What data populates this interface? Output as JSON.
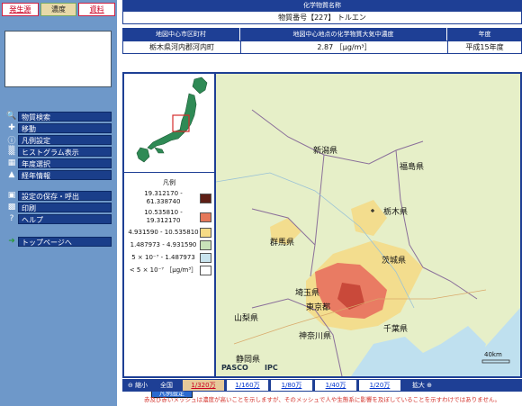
{
  "tabs": [
    {
      "label": "発生源",
      "active": false
    },
    {
      "label": "濃度",
      "active": true
    },
    {
      "label": "資料",
      "active": false
    }
  ],
  "menu1": [
    {
      "icon": "search-icon",
      "label": "物質検索"
    },
    {
      "icon": "move-icon",
      "label": "移動"
    },
    {
      "icon": "info-icon",
      "label": "凡例設定"
    },
    {
      "icon": "histogram-icon",
      "label": "ヒストグラム表示"
    },
    {
      "icon": "calendar-icon",
      "label": "年度選択"
    },
    {
      "icon": "chart-icon",
      "label": "経年情報"
    }
  ],
  "menu2": [
    {
      "icon": "save-icon",
      "label": "設定の保存・呼出"
    },
    {
      "icon": "print-icon",
      "label": "印刷"
    },
    {
      "icon": "help-icon",
      "label": "ヘルプ"
    }
  ],
  "menu3": [
    {
      "icon": "home-arrow-icon",
      "label": "トップページへ"
    }
  ],
  "header": {
    "title": "化学物質名称",
    "substance": "物質番号【227】 トルエン",
    "col1": "地図中心市区町村",
    "col2": "地図中心地点の化学物質大気中濃度",
    "col3": "年度",
    "city": "栃木県河内郡河内町",
    "conc": "2.87 ［µg/m³］",
    "year": "平成15年度"
  },
  "legend": {
    "title": "凡例",
    "items": [
      {
        "label": "19.312170 - 61.338740",
        "color": "#5e1f16"
      },
      {
        "label": "10.535810 - 19.312170",
        "color": "#e5785a"
      },
      {
        "label": "4.931590 - 10.535810",
        "color": "#f6db86"
      },
      {
        "label": "1.487973 - 4.931590",
        "color": "#c9e2b9"
      },
      {
        "label": "5 × 10⁻⁷ - 1.487973",
        "color": "#c9e4ee"
      },
      {
        "label": "< 5 × 10⁻⁷ ［µg/m³］",
        "color": "#ffffff"
      }
    ],
    "button": "凡例設定"
  },
  "map": {
    "labels": {
      "niigata": "新潟県",
      "fukushima": "福島県",
      "tochigi": "栃木県",
      "gunma": "群馬県",
      "ibaraki": "茨城県",
      "saitama": "埼玉県",
      "tokyo": "東京都",
      "yamanashi": "山梨県",
      "kanagawa": "神奈川県",
      "chiba": "千葉県",
      "shizuoka": "静岡県"
    },
    "credit": "PASCO",
    "credit2": "IPC",
    "scale_label": "40km"
  },
  "scalebar": {
    "zoomout": "縮小",
    "all": "全国",
    "options": [
      "1/320万",
      "1/160万",
      "1/80万",
      "1/40万",
      "1/20万"
    ],
    "current": 0,
    "zoomin": "拡大"
  },
  "note": "赤及び赤いメッシュは濃度が高いことを示しますが、そのメッシュで人や生態系に影響を及ぼしていることを示すわけではありません。"
}
